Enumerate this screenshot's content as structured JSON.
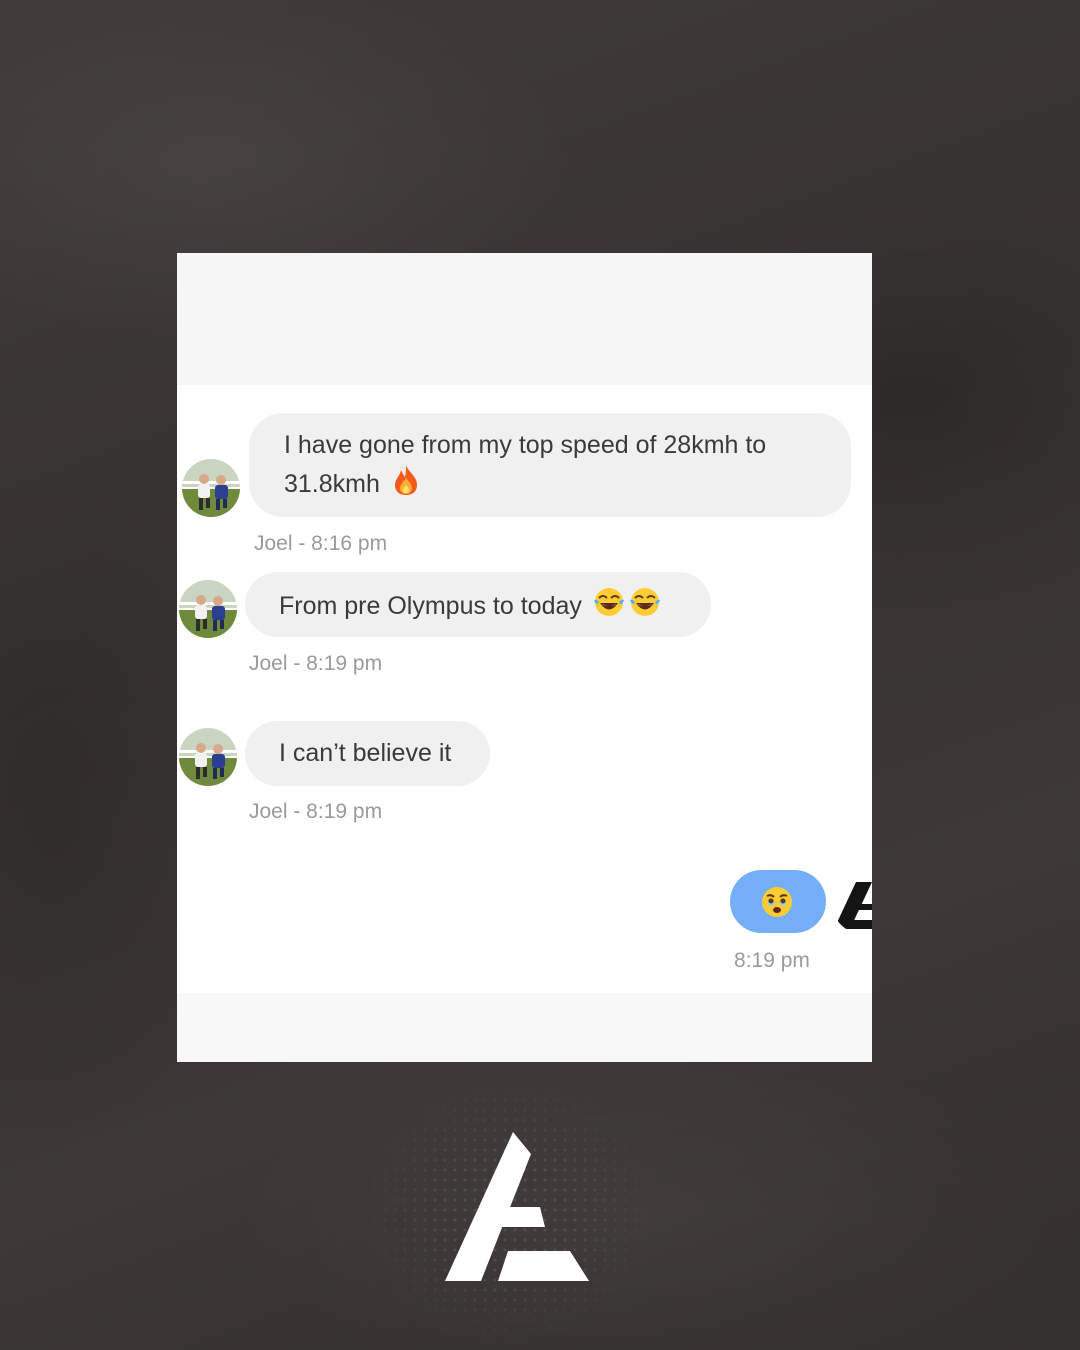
{
  "messages": [
    {
      "sender": "Joel",
      "lines": [
        "I have gone from my top speed of 28kmh to",
        "31.8kmh"
      ],
      "emoji": [
        "fire"
      ],
      "meta": "Joel - 8:16 pm"
    },
    {
      "sender": "Joel",
      "text": "From pre Olympus to today",
      "emoji": [
        "face-with-tears-of-joy",
        "face-with-tears-of-joy"
      ],
      "meta": "Joel - 8:19 pm"
    },
    {
      "sender": "Joel",
      "text": "I can’t believe it",
      "meta": "Joel - 8:19 pm"
    }
  ],
  "sent_message": {
    "emoji": "face-holding-back-tears",
    "time": "8:19 pm",
    "bubble_color": "#74aef7"
  },
  "colors": {
    "background": "#3a3635",
    "received_bubble": "#f0f0f0",
    "meta_text": "#9a9a9a"
  }
}
